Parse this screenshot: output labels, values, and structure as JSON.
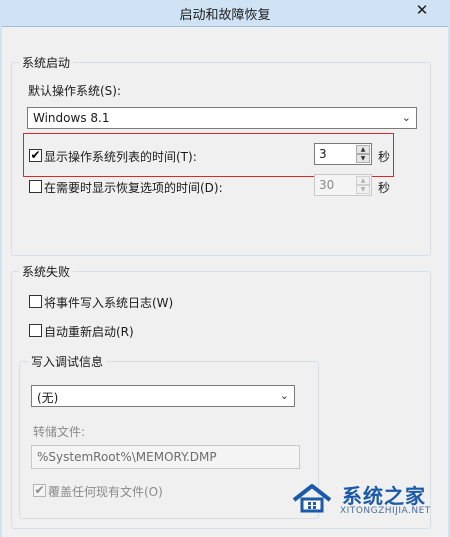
{
  "window": {
    "title": "启动和故障恢复",
    "close_glyph": "✕"
  },
  "system_startup": {
    "legend": "系统启动",
    "default_os_label": "默认操作系统(S):",
    "default_os_value": "Windows 8.1",
    "show_os_list": {
      "checked": true,
      "label": "显示操作系统列表的时间(T):",
      "value": "3",
      "unit": "秒"
    },
    "show_recovery": {
      "checked": false,
      "label": "在需要时显示恢复选项的时间(D):",
      "value": "30",
      "unit": "秒"
    }
  },
  "system_failure": {
    "legend": "系统失败",
    "write_event_log": {
      "checked": false,
      "label": "将事件写入系统日志(W)"
    },
    "auto_restart": {
      "checked": false,
      "label": "自动重新启动(R)"
    },
    "debug_info": {
      "legend": "写入调试信息",
      "select_value": "(无)",
      "dump_file_label": "转储文件:",
      "dump_file_value": "%SystemRoot%\\MEMORY.DMP",
      "overwrite": {
        "checked": true,
        "label": "覆盖任何现有文件(O)"
      }
    }
  },
  "icons": {
    "check": "✔",
    "dropdown": "⌄",
    "spin_up": "▲",
    "spin_down": "▼"
  },
  "watermark": {
    "name": "系统之家",
    "url": "XITONGZHIJIA.NET"
  },
  "colors": {
    "highlight": "#d9292b",
    "titlebar": "#cfe3f4"
  }
}
